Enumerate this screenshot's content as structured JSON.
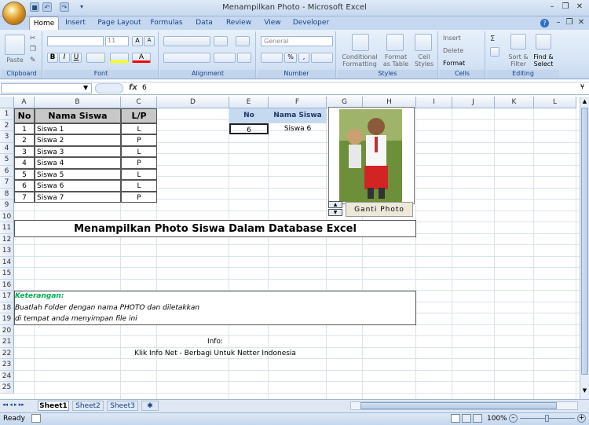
{
  "window": {
    "title": "Menampilkan Photo - Microsoft Excel"
  },
  "tabs": [
    "Home",
    "Insert",
    "Page Layout",
    "Formulas",
    "Data",
    "Review",
    "View",
    "Developer"
  ],
  "ribbon": {
    "clipboard": {
      "label": "Clipboard",
      "paste": "Paste"
    },
    "font": {
      "label": "Font",
      "size": "11"
    },
    "alignment": {
      "label": "Alignment"
    },
    "number": {
      "label": "Number",
      "format": "General"
    },
    "styles": {
      "label": "Styles",
      "conditional": "Conditional Formatting",
      "format_table": "Format as Table",
      "cell_styles": "Cell Styles"
    },
    "cells": {
      "label": "Cells",
      "insert": "Insert",
      "delete": "Delete",
      "format": "Format"
    },
    "editing": {
      "label": "Editing",
      "sort": "Sort & Filter",
      "find": "Find & Select"
    }
  },
  "formula_bar": {
    "name_box": "",
    "fx": "fx",
    "value": "6"
  },
  "columns": [
    "A",
    "B",
    "C",
    "D",
    "E",
    "F",
    "G",
    "H",
    "I",
    "J",
    "K",
    "L"
  ],
  "rows": [
    "1",
    "2",
    "3",
    "4",
    "5",
    "6",
    "7",
    "8",
    "9",
    "10",
    "11",
    "12",
    "13",
    "14",
    "15",
    "16",
    "17",
    "18",
    "19",
    "20",
    "21",
    "22",
    "23",
    "24",
    "25"
  ],
  "table": {
    "headers": [
      "No",
      "Nama Siswa",
      "L/P"
    ],
    "rows": [
      [
        "1",
        "Siswa 1",
        "L"
      ],
      [
        "2",
        "Siswa 2",
        "P"
      ],
      [
        "3",
        "Siswa 3",
        "L"
      ],
      [
        "4",
        "Siswa 4",
        "P"
      ],
      [
        "5",
        "Siswa 5",
        "L"
      ],
      [
        "6",
        "Siswa 6",
        "L"
      ],
      [
        "7",
        "Siswa 7",
        "P"
      ]
    ]
  },
  "lookup": {
    "headers": [
      "No",
      "Nama Siswa"
    ],
    "no": "6",
    "name": "Siswa 6"
  },
  "photo_button": "Ganti Photo",
  "banner": "Menampilkan Photo Siswa Dalam Database Excel",
  "notes": {
    "title": "Keterangan:",
    "line1": "Buatlah Folder dengan nama PHOTO dan diletakkan",
    "line2": "di tempat anda menyimpan file ini"
  },
  "info": {
    "label": "Info:",
    "text": "Klik Info Net - Berbagi Untuk Netter Indonesia"
  },
  "sheets": [
    "Sheet1",
    "Sheet2",
    "Sheet3"
  ],
  "status": {
    "ready": "Ready",
    "zoom": "100%"
  },
  "colors": {
    "accent": "#15428b",
    "green_note": "#00b050",
    "lookup_header": "#c5d9f1"
  }
}
